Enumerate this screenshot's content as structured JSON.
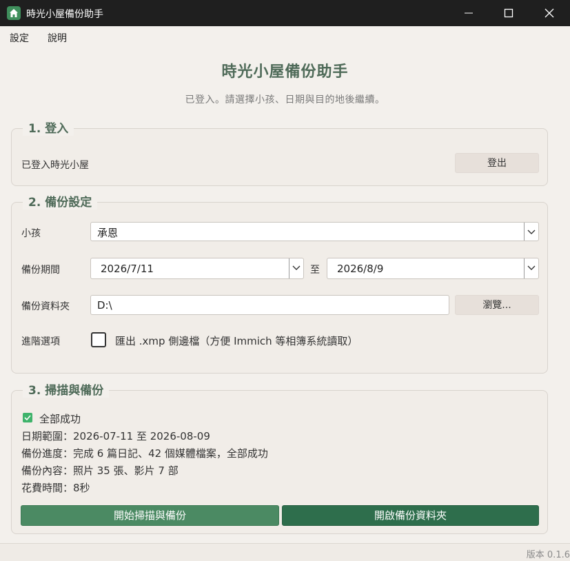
{
  "window": {
    "title": "時光小屋備份助手",
    "icon": "house-icon"
  },
  "menu": {
    "settings": "設定",
    "help": "說明"
  },
  "header": {
    "title": "時光小屋備份助手",
    "subtitle": "已登入。請選擇小孩、日期與目的地後繼續。"
  },
  "login": {
    "group_title": "1. 登入",
    "status": "已登入時光小屋",
    "logout_label": "登出"
  },
  "settings": {
    "group_title": "2. 備份設定",
    "child_label": "小孩",
    "child_value": "承恩",
    "period_label": "備份期間",
    "start_date": "2026/7/11",
    "to_label": "至",
    "end_date": "2026/8/9",
    "folder_label": "備份資料夾",
    "folder_value": "D:\\",
    "browse_label": "瀏覽...",
    "advanced_label": "進階選項",
    "xmp_label": "匯出 .xmp 側邊檔（方便 Immich 等相簿系統讀取）",
    "xmp_checked": false
  },
  "scan": {
    "group_title": "3. 掃描與備份",
    "status": "全部成功",
    "date_range": "日期範圍：2026-07-11 至 2026-08-09",
    "progress": "備份進度：完成 6 篇日記、42 個媒體檔案，全部成功",
    "contents": "備份內容：照片 35 張、影片 7 部",
    "elapsed": "花費時間：8秒",
    "start_button": "開始掃描與備份",
    "open_button": "開啟備份資料夾"
  },
  "status_bar": {
    "version": "版本 0.1.6"
  },
  "colors": {
    "accent": "#4e6a58",
    "primary_button": "#4b8a63",
    "secondary_button": "#2e6e4c",
    "success": "#3fb36b"
  }
}
